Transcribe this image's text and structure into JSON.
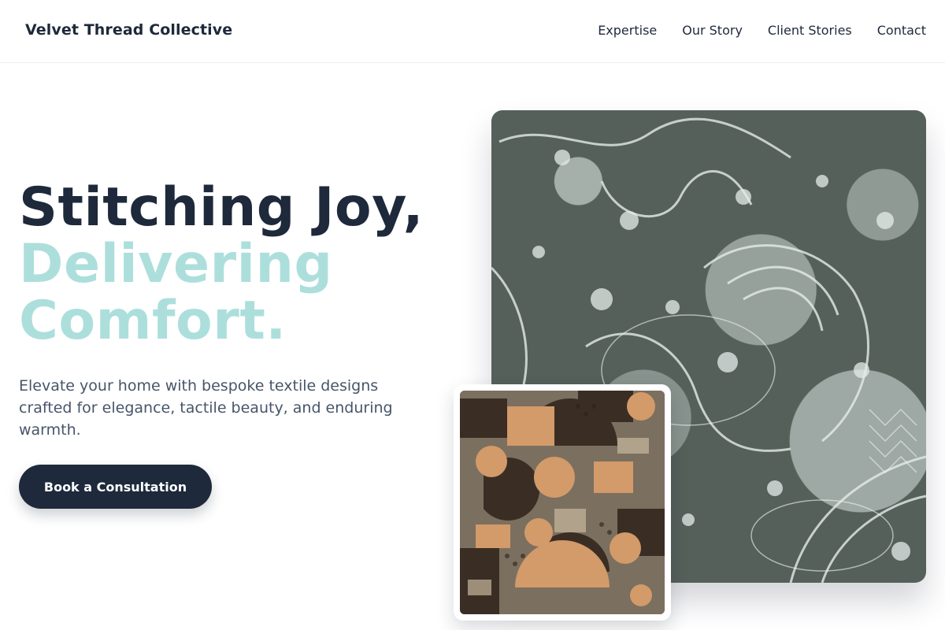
{
  "header": {
    "brand": "Velvet Thread Collective",
    "nav": [
      "Expertise",
      "Our Story",
      "Client Stories",
      "Contact"
    ]
  },
  "hero": {
    "headline_line1": "Stitching Joy,",
    "headline_line2": "Delivering",
    "headline_line3": "Comfort.",
    "subtext": "Elevate your home with bespoke textile designs crafted for elegance, tactile beauty, and enduring warmth.",
    "cta_label": "Book a Consultation"
  },
  "images": {
    "main": "lace-fabric-photo",
    "secondary": "geometric-pattern-fabric-photo"
  },
  "colors": {
    "navy": "#1e293b",
    "teal": "#acdfdc",
    "body_text": "#475569"
  }
}
